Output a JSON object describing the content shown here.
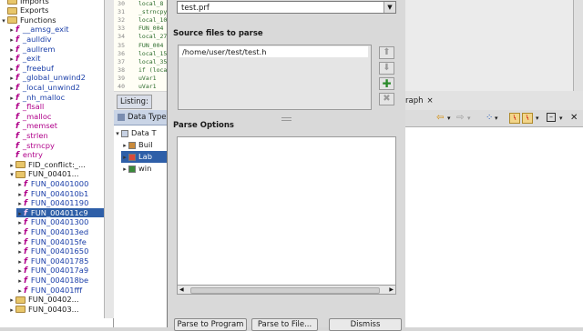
{
  "tree": {
    "items": [
      {
        "icon": "folder",
        "label": "Imports",
        "indent": 1,
        "toggle": ""
      },
      {
        "icon": "folder",
        "label": "Exports",
        "indent": 1,
        "toggle": ""
      },
      {
        "icon": "folder",
        "label": "Functions",
        "indent": 1,
        "toggle": "▾"
      },
      {
        "icon": "fn",
        "label": "__amsg_exit",
        "indent": 2,
        "toggle": "▸",
        "color": "blue"
      },
      {
        "icon": "fn",
        "label": "_aulldiv",
        "indent": 2,
        "toggle": "▸",
        "color": "blue"
      },
      {
        "icon": "fn",
        "label": "_aullrem",
        "indent": 2,
        "toggle": "▸",
        "color": "blue"
      },
      {
        "icon": "fn",
        "label": "_exit",
        "indent": 2,
        "toggle": "▸",
        "color": "blue"
      },
      {
        "icon": "fn",
        "label": "_freebuf",
        "indent": 2,
        "toggle": "▸",
        "color": "blue"
      },
      {
        "icon": "fn",
        "label": "_global_unwind2",
        "indent": 2,
        "toggle": "▸",
        "color": "blue"
      },
      {
        "icon": "fn",
        "label": "_local_unwind2",
        "indent": 2,
        "toggle": "▸",
        "color": "blue"
      },
      {
        "icon": "fn",
        "label": "_nh_malloc",
        "indent": 2,
        "toggle": "▸",
        "color": "blue"
      },
      {
        "icon": "fn",
        "label": "_flsall",
        "indent": 2,
        "toggle": "",
        "color": "red"
      },
      {
        "icon": "fn",
        "label": "_malloc",
        "indent": 2,
        "toggle": "",
        "color": "red"
      },
      {
        "icon": "fn",
        "label": "_memset",
        "indent": 2,
        "toggle": "",
        "color": "red"
      },
      {
        "icon": "fn",
        "label": "_strlen",
        "indent": 2,
        "toggle": "",
        "color": "red"
      },
      {
        "icon": "fn",
        "label": "_strncpy",
        "indent": 2,
        "toggle": "",
        "color": "red"
      },
      {
        "icon": "fn",
        "label": "entry",
        "indent": 2,
        "toggle": "",
        "color": "red"
      },
      {
        "icon": "folder",
        "label": "FID_conflict:_...",
        "indent": 2,
        "toggle": "▸"
      },
      {
        "icon": "folder",
        "label": "FUN_00401...",
        "indent": 2,
        "toggle": "▾"
      },
      {
        "icon": "fn",
        "label": "FUN_00401000",
        "indent": 3,
        "toggle": "▸",
        "color": "blue"
      },
      {
        "icon": "fn",
        "label": "FUN_004010b1",
        "indent": 3,
        "toggle": "▸",
        "color": "blue"
      },
      {
        "icon": "fn",
        "label": "FUN_00401190",
        "indent": 3,
        "toggle": "▸",
        "color": "blue"
      },
      {
        "icon": "fn",
        "label": "FUN_004011c9",
        "indent": 3,
        "toggle": "▸",
        "color": "blue",
        "selected": true
      },
      {
        "icon": "fn",
        "label": "FUN_00401300",
        "indent": 3,
        "toggle": "▸",
        "color": "blue"
      },
      {
        "icon": "fn",
        "label": "FUN_004013ed",
        "indent": 3,
        "toggle": "▸",
        "color": "blue"
      },
      {
        "icon": "fn",
        "label": "FUN_004015fe",
        "indent": 3,
        "toggle": "▸",
        "color": "blue"
      },
      {
        "icon": "fn",
        "label": "FUN_00401650",
        "indent": 3,
        "toggle": "▸",
        "color": "blue"
      },
      {
        "icon": "fn",
        "label": "FUN_00401785",
        "indent": 3,
        "toggle": "▸",
        "color": "blue"
      },
      {
        "icon": "fn",
        "label": "FUN_004017a9",
        "indent": 3,
        "toggle": "▸",
        "color": "blue"
      },
      {
        "icon": "fn",
        "label": "FUN_004018be",
        "indent": 3,
        "toggle": "▸",
        "color": "blue"
      },
      {
        "icon": "fn",
        "label": "FUN_00401fff",
        "indent": 3,
        "toggle": "▸",
        "color": "blue"
      },
      {
        "icon": "folder",
        "label": "FUN_00402...",
        "indent": 2,
        "toggle": "▸"
      },
      {
        "icon": "folder",
        "label": "FUN_00403...",
        "indent": 2,
        "toggle": "▸"
      }
    ]
  },
  "listing": {
    "lines": [
      {
        "num": "30",
        "code": "local_8"
      },
      {
        "num": "31",
        "code": "_strncpy"
      },
      {
        "num": "32",
        "code": "local_10"
      },
      {
        "num": "33",
        "code": "FUN_004"
      },
      {
        "num": "34",
        "code": "local_27"
      },
      {
        "num": "35",
        "code": "FUN_004"
      },
      {
        "num": "36",
        "code": "local_15"
      },
      {
        "num": "37",
        "code": "local_35"
      },
      {
        "num": "38",
        "code": "if (local"
      },
      {
        "num": "39",
        "code": "  uVar1"
      },
      {
        "num": "40",
        "code": "  uVar1"
      }
    ],
    "tab_label": "Listing:"
  },
  "datatypes": {
    "header": "Data Type",
    "rows": [
      {
        "label": "Data T",
        "toggle": "▾",
        "indent": 0
      },
      {
        "label": "Buil",
        "toggle": "▸",
        "indent": 1
      },
      {
        "label": "Lab",
        "toggle": "▸",
        "indent": 1,
        "selected": true
      },
      {
        "label": "win",
        "toggle": "▸",
        "indent": 1
      }
    ]
  },
  "dialog": {
    "profile_value": "test.prf",
    "source_files_label": "Source files to parse",
    "source_file": "/home/user/test/test.h",
    "parse_options_label": "Parse Options",
    "buttons": {
      "parse_program": "Parse to Program",
      "parse_file": "Parse to File...",
      "dismiss": "Dismiss"
    }
  },
  "right": {
    "graph_tab": "raph",
    "graph_close": "×"
  },
  "colors": {
    "selection": "#2e5fa8",
    "function_icon": "#b0008a",
    "add_button": "#2a8a2a"
  }
}
